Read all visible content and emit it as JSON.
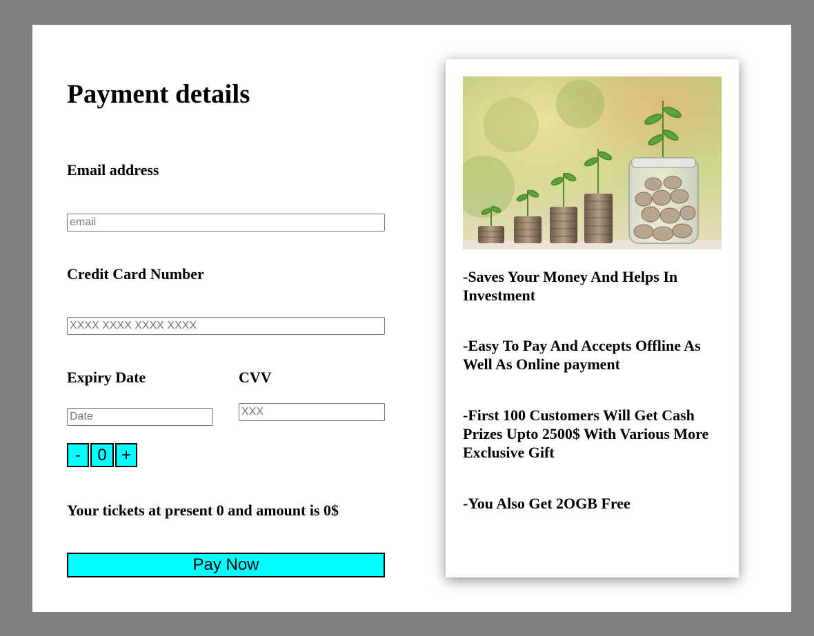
{
  "form": {
    "title": "Payment details",
    "email_label": "Email address",
    "email_placeholder": "email",
    "card_label": "Credit Card Number",
    "card_placeholder": "XXXX XXXX XXXX XXXX",
    "expiry_label": "Expiry Date",
    "expiry_placeholder": "Date",
    "cvv_label": "CVV",
    "cvv_placeholder": "XXX",
    "stepper": {
      "minus_label": "-",
      "value": "0",
      "plus_label": "+"
    },
    "summary": "Your tickets at present 0 and amount is 0$",
    "pay_button": "Pay Now"
  },
  "promo": {
    "image_icon": "coins-plant-growth-image",
    "perks": [
      "-Saves Your Money And Helps In Investment",
      "-Easy To Pay And Accepts Offline As Well As Online payment",
      "-First 100 Customers Will Get Cash Prizes Upto 2500$ With Various More Exclusive Gift",
      "-You Also Get 2OGB Free"
    ]
  },
  "colors": {
    "background": "#808080",
    "card": "#ffffff",
    "accent": "#00ffff"
  }
}
